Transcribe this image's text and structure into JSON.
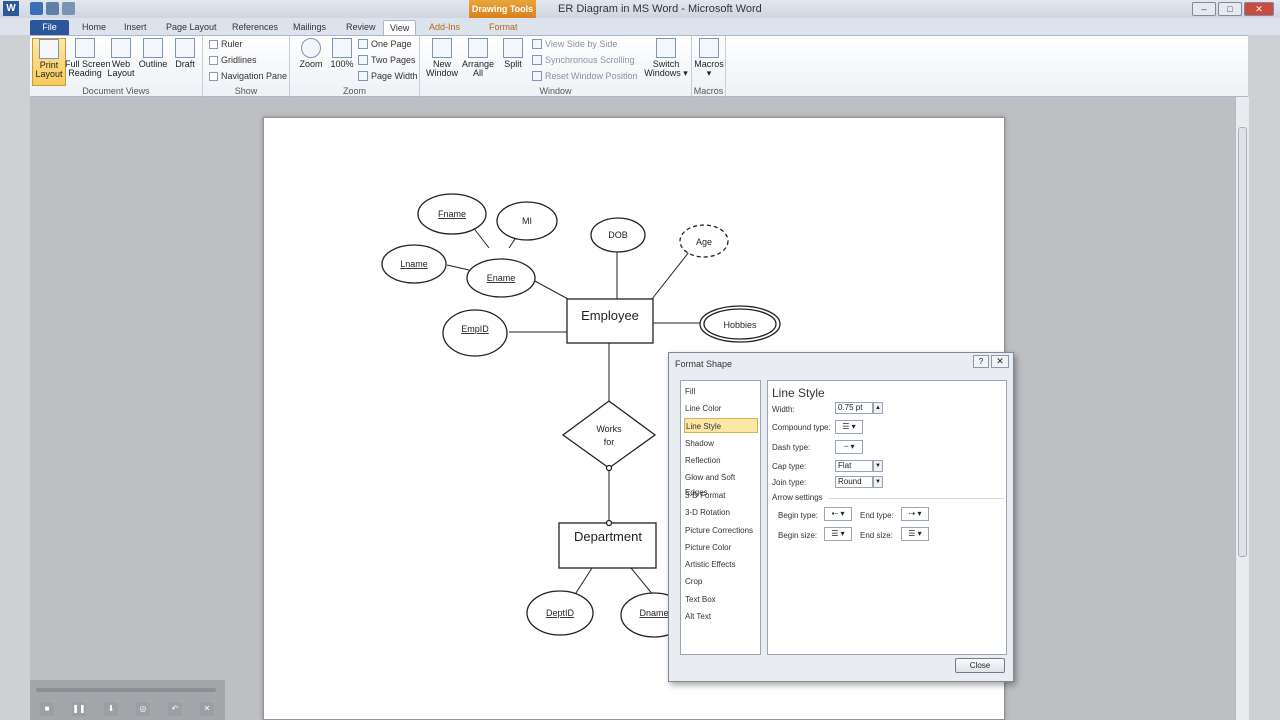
{
  "window": {
    "title": "ER Diagram in MS Word  -  Microsoft Word",
    "context_tab_header": "Drawing Tools",
    "controls": {
      "minimize": "–",
      "maximize": "□",
      "close": "✕"
    }
  },
  "tabs": [
    {
      "label": "File"
    },
    {
      "label": "Home"
    },
    {
      "label": "Insert"
    },
    {
      "label": "Page Layout"
    },
    {
      "label": "References"
    },
    {
      "label": "Mailings"
    },
    {
      "label": "Review"
    },
    {
      "label": "View",
      "active": true
    },
    {
      "label": "Add-Ins"
    },
    {
      "label": "Format"
    }
  ],
  "ribbon": {
    "document_views": {
      "label": "Document Views",
      "buttons": [
        {
          "label": "Print\nLayout",
          "active": true
        },
        {
          "label": "Full Screen\nReading"
        },
        {
          "label": "Web\nLayout"
        },
        {
          "label": "Outline"
        },
        {
          "label": "Draft"
        }
      ]
    },
    "show": {
      "label": "Show",
      "items": [
        "Ruler",
        "Gridlines",
        "Navigation Pane"
      ]
    },
    "zoom": {
      "label": "Zoom",
      "buttons": [
        "Zoom",
        "100%"
      ],
      "items": [
        "One Page",
        "Two Pages",
        "Page Width"
      ]
    },
    "window": {
      "label": "Window",
      "buttons": [
        "New\nWindow",
        "Arrange\nAll",
        "Split"
      ],
      "items": [
        "View Side by Side",
        "Synchronous Scrolling",
        "Reset Window Position"
      ],
      "switch": "Switch\nWindows ▾"
    },
    "macros": {
      "label": "Macros",
      "button": "Macros\n▾"
    }
  },
  "er_diagram": {
    "entities": [
      "Employee",
      "Department"
    ],
    "relationship": "Works\nfor",
    "attributes": [
      "Fname",
      "MI",
      "Lname",
      "Ename",
      "DOB",
      "Age",
      "EmpID",
      "Hobbies",
      "DeptID",
      "Dname"
    ]
  },
  "format_shape": {
    "title": "Format Shape",
    "help": "?",
    "close_x": "✕",
    "categories": [
      "Fill",
      "Line Color",
      "Line Style",
      "Shadow",
      "Reflection",
      "Glow and Soft Edges",
      "3-D Format",
      "3-D Rotation",
      "Picture Corrections",
      "Picture Color",
      "Artistic Effects",
      "Crop",
      "Text Box",
      "Alt Text"
    ],
    "selected_category": "Line Style",
    "panel": {
      "title": "Line Style",
      "width_label": "Width:",
      "width_value": "0.75 pt",
      "compound_label": "Compound type:",
      "dash_label": "Dash type:",
      "cap_label": "Cap type:",
      "cap_value": "Flat",
      "join_label": "Join type:",
      "join_value": "Round",
      "arrow_settings": "Arrow settings",
      "begin_type": "Begin type:",
      "end_type": "End type:",
      "begin_size": "Begin size:",
      "end_size": "End size:"
    },
    "close_button": "Close"
  }
}
